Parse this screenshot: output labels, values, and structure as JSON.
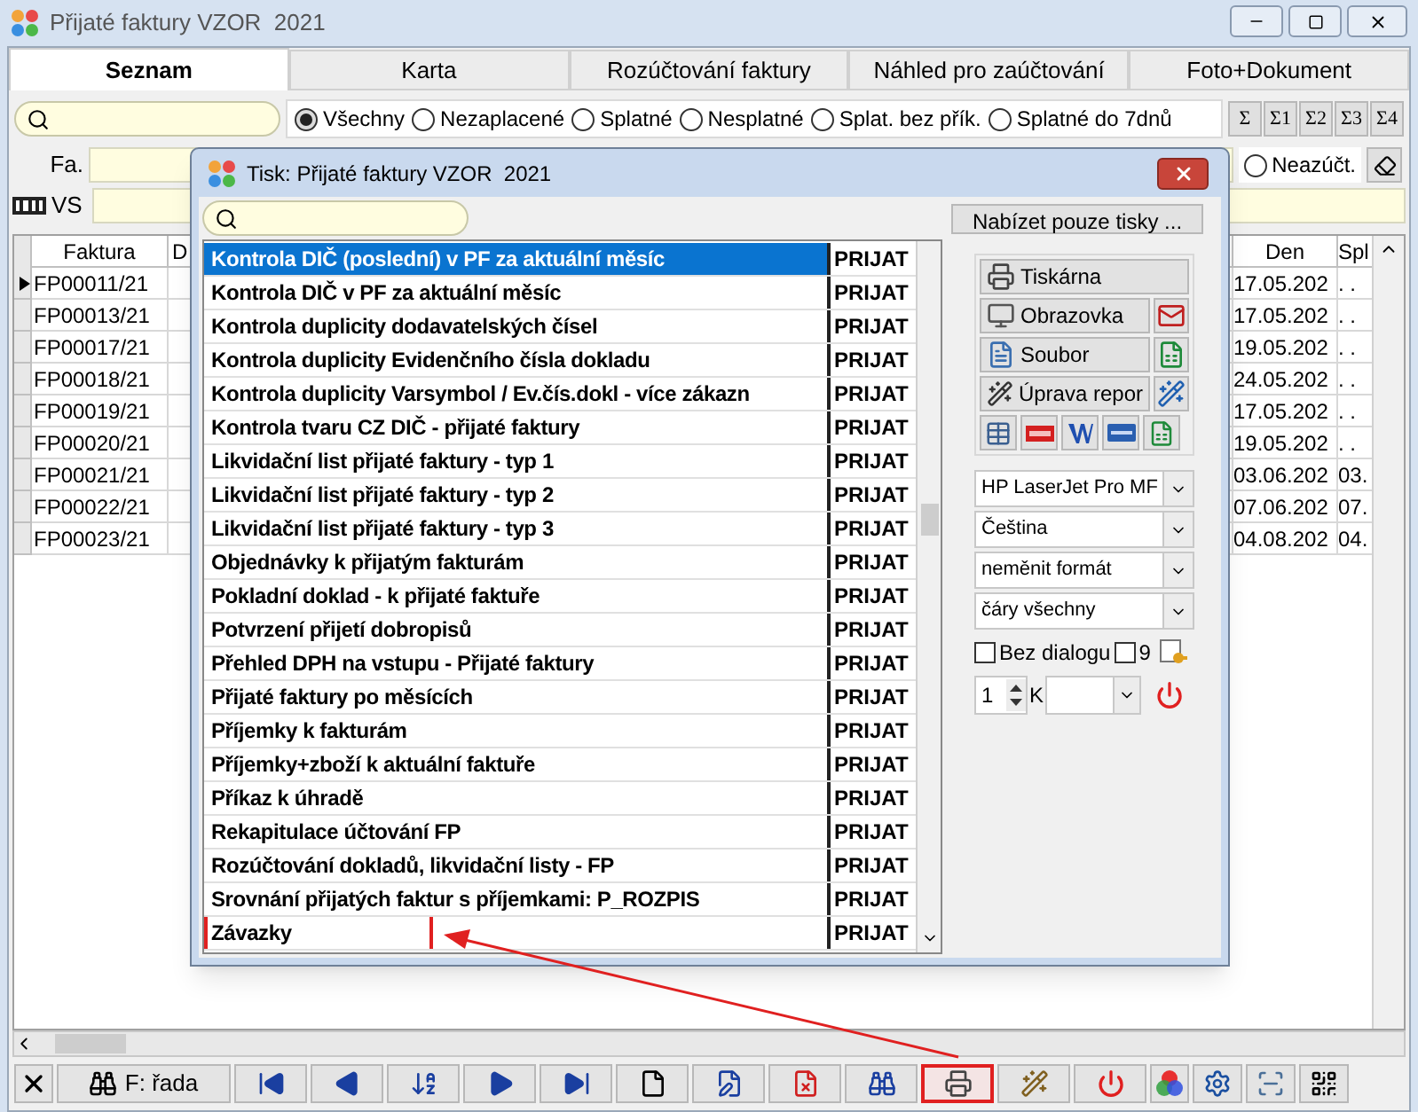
{
  "window": {
    "title": "Přijaté faktury VZOR  2021"
  },
  "tabs": [
    {
      "label": "Seznam",
      "selected": true
    },
    {
      "label": "Karta",
      "selected": false
    },
    {
      "label": "Rozúčtování faktury",
      "selected": false
    },
    {
      "label": "Náhled pro zaúčtování",
      "selected": false
    },
    {
      "label": "Foto+Dokument",
      "selected": false
    }
  ],
  "filters": [
    {
      "label": "Všechny",
      "selected": true
    },
    {
      "label": "Nezaplacené",
      "selected": false
    },
    {
      "label": "Splatné",
      "selected": false
    },
    {
      "label": "Nesplatné",
      "selected": false
    },
    {
      "label": "Splat. bez přík.",
      "selected": false
    },
    {
      "label": "Splatné do 7dnů",
      "selected": false
    }
  ],
  "sum_buttons": [
    "Σ",
    "Σ1",
    "Σ2",
    "Σ3",
    "Σ4"
  ],
  "extra_filter": {
    "label": "Neazúčt.",
    "selected": false
  },
  "fields": [
    {
      "label": "Fa."
    },
    {
      "label": "VS"
    }
  ],
  "table": {
    "columns": [
      "Faktura",
      "D",
      "Den",
      "Spl"
    ],
    "rows": [
      {
        "faktura": "FP00011/21",
        "den": "17.05.202",
        "spl": ". .",
        "selected": true
      },
      {
        "faktura": "FP00013/21",
        "den": "17.05.202",
        "spl": ". .",
        "selected": false
      },
      {
        "faktura": "FP00017/21",
        "den": "19.05.202",
        "spl": ". .",
        "selected": false
      },
      {
        "faktura": "FP00018/21",
        "den": "24.05.202",
        "spl": ". .",
        "selected": false
      },
      {
        "faktura": "FP00019/21",
        "den": "17.05.202",
        "spl": ". .",
        "selected": false
      },
      {
        "faktura": "FP00020/21",
        "den": "19.05.202",
        "spl": ". .",
        "selected": false
      },
      {
        "faktura": "FP00021/21",
        "den": "03.06.202",
        "spl": "03.",
        "selected": false
      },
      {
        "faktura": "FP00022/21",
        "den": "07.06.202",
        "spl": "07.",
        "selected": false
      },
      {
        "faktura": "FP00023/21",
        "den": "04.08.202",
        "spl": "04.",
        "selected": false
      }
    ]
  },
  "dialog": {
    "title": "Tisk: Přijaté faktury VZOR  2021",
    "filter_button": "Nabízet pouze tisky ...",
    "reports": [
      {
        "name": "Kontrola DIČ (poslední) v PF za aktuální měsíc",
        "module": "PRIJAT",
        "selected": true,
        "highlighted": false
      },
      {
        "name": "Kontrola DIČ v PF za aktuální měsíc",
        "module": "PRIJAT",
        "selected": false,
        "highlighted": false
      },
      {
        "name": "Kontrola duplicity dodavatelských čísel",
        "module": "PRIJAT",
        "selected": false,
        "highlighted": false
      },
      {
        "name": "Kontrola duplicity Evidenčního čísla dokladu",
        "module": "PRIJAT",
        "selected": false,
        "highlighted": false
      },
      {
        "name": "Kontrola duplicity Varsymbol / Ev.čís.dokl - více zákazn",
        "module": "PRIJAT",
        "selected": false,
        "highlighted": false
      },
      {
        "name": "Kontrola tvaru CZ DIČ - přijaté faktury",
        "module": "PRIJAT",
        "selected": false,
        "highlighted": false
      },
      {
        "name": "Likvidační list přijaté faktury - typ 1",
        "module": "PRIJAT",
        "selected": false,
        "highlighted": false
      },
      {
        "name": "Likvidační list přijaté faktury - typ 2",
        "module": "PRIJAT",
        "selected": false,
        "highlighted": false
      },
      {
        "name": "Likvidační list přijaté faktury - typ 3",
        "module": "PRIJAT",
        "selected": false,
        "highlighted": false
      },
      {
        "name": "Objednávky k přijatým fakturám",
        "module": "PRIJAT",
        "selected": false,
        "highlighted": false
      },
      {
        "name": "Pokladní doklad - k přijaté faktuře",
        "module": "PRIJAT",
        "selected": false,
        "highlighted": false
      },
      {
        "name": "Potvrzení přijetí dobropisů",
        "module": "PRIJAT",
        "selected": false,
        "highlighted": false
      },
      {
        "name": "Přehled DPH na vstupu - Přijaté faktury",
        "module": "PRIJAT",
        "selected": false,
        "highlighted": false
      },
      {
        "name": "Přijaté faktury po měsících",
        "module": "PRIJAT",
        "selected": false,
        "highlighted": false
      },
      {
        "name": "Příjemky k fakturám",
        "module": "PRIJAT",
        "selected": false,
        "highlighted": false
      },
      {
        "name": "Příjemky+zboží k aktuální faktuře",
        "module": "PRIJAT",
        "selected": false,
        "highlighted": false
      },
      {
        "name": "Příkaz k úhradě",
        "module": "PRIJAT",
        "selected": false,
        "highlighted": false
      },
      {
        "name": "Rekapitulace účtování FP",
        "module": "PRIJAT",
        "selected": false,
        "highlighted": false
      },
      {
        "name": "Rozúčtování dokladů, likvidační listy - FP",
        "module": "PRIJAT",
        "selected": false,
        "highlighted": false
      },
      {
        "name": "Srovnání přijatých faktur s příjemkami: P_ROZPIS",
        "module": "PRIJAT",
        "selected": false,
        "highlighted": false
      },
      {
        "name": "Závazky",
        "module": "PRIJAT",
        "selected": false,
        "highlighted": true
      }
    ],
    "output_buttons": [
      {
        "kind": "printer",
        "label": "Tiskárna"
      },
      {
        "kind": "screen",
        "label": "Obrazovka"
      },
      {
        "kind": "file",
        "label": "Soubor"
      },
      {
        "kind": "report",
        "label": "Úprava repor"
      }
    ],
    "selects": [
      "HP LaserJet Pro MF",
      "Čeština",
      "neměnit formát",
      "čáry všechny"
    ],
    "checks": [
      {
        "label": "Bez dialogu",
        "checked": false
      },
      {
        "label": "9",
        "checked": false
      }
    ],
    "copies": "1",
    "copies_label": "K"
  },
  "toolbar": [
    {
      "kind": "close",
      "highlighted": false
    },
    {
      "kind": "range",
      "label": "F: řada",
      "highlighted": false
    },
    {
      "kind": "first",
      "highlighted": false
    },
    {
      "kind": "prev",
      "highlighted": false
    },
    {
      "kind": "sort",
      "highlighted": false
    },
    {
      "kind": "next",
      "highlighted": false
    },
    {
      "kind": "last",
      "highlighted": false
    },
    {
      "kind": "new",
      "highlighted": false
    },
    {
      "kind": "edit",
      "highlighted": false
    },
    {
      "kind": "delete",
      "highlighted": false
    },
    {
      "kind": "find",
      "highlighted": false
    },
    {
      "kind": "print",
      "highlighted": true
    },
    {
      "kind": "report",
      "highlighted": false
    },
    {
      "kind": "power",
      "highlighted": false
    },
    {
      "kind": "colors",
      "highlighted": false
    },
    {
      "kind": "settings",
      "highlighted": false
    },
    {
      "kind": "scan",
      "highlighted": false
    },
    {
      "kind": "qr",
      "highlighted": false
    }
  ]
}
